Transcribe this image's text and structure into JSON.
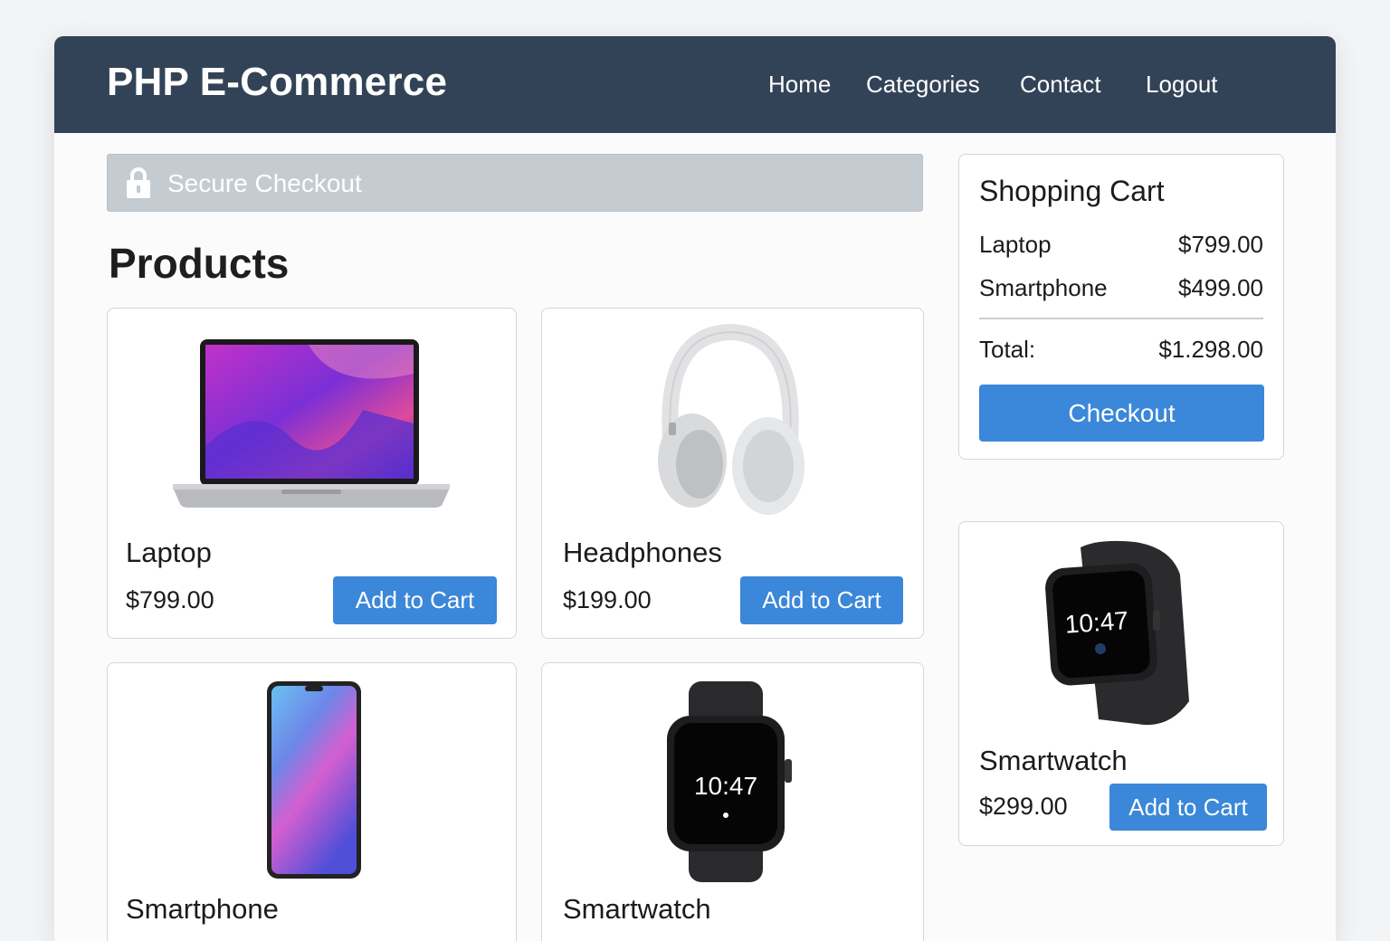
{
  "app": {
    "brand": "PHP E-Commerce"
  },
  "nav": {
    "items": [
      {
        "label": "Home"
      },
      {
        "label": "Categories"
      },
      {
        "label": "Contact"
      },
      {
        "label": "Logout"
      }
    ]
  },
  "banner": {
    "text": "Secure Checkout",
    "icon": "lock-icon"
  },
  "main": {
    "heading": "Products"
  },
  "products": [
    {
      "name": "Laptop",
      "price": "$799.00",
      "button": "Add to Cart",
      "icon": "laptop-image"
    },
    {
      "name": "Headphones",
      "price": "$199.00",
      "button": "Add to Cart",
      "icon": "headphones-image"
    },
    {
      "name": "Smartphone",
      "icon": "smartphone-image"
    },
    {
      "name": "Smartwatch",
      "icon": "smartwatch-image",
      "watch_time": "10:47"
    }
  ],
  "cart": {
    "title": "Shopping Cart",
    "items": [
      {
        "name": "Laptop",
        "price": "$799.00"
      },
      {
        "name": "Smartphone",
        "price": "$499.00"
      }
    ],
    "total_label": "Total:",
    "total_value": "$1.298.00",
    "checkout_label": "Checkout"
  },
  "featured": {
    "name": "Smartwatch",
    "price": "$299.00",
    "button": "Add to Cart",
    "watch_time": "10:47"
  },
  "colors": {
    "navbar": "#334357",
    "accent": "#3b87d9",
    "banner": "#c4cbd1"
  }
}
